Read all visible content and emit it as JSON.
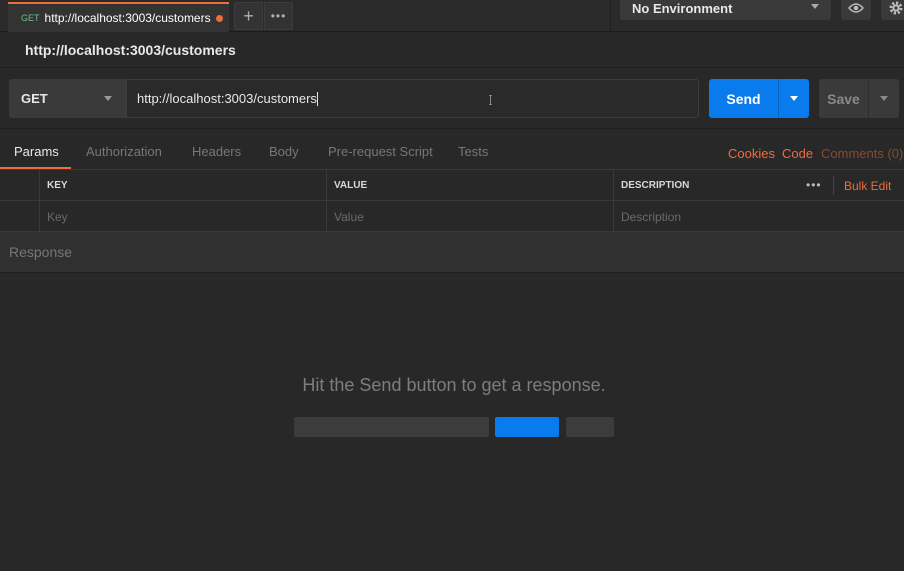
{
  "tab": {
    "method": "GET",
    "title": "http://localhost:3003/customers"
  },
  "environment": {
    "selected": "No Environment"
  },
  "request": {
    "name": "http://localhost:3003/customers",
    "method": "GET",
    "url": "http://localhost:3003/customers",
    "send_label": "Send",
    "save_label": "Save"
  },
  "request_tabs": [
    "Params",
    "Authorization",
    "Headers",
    "Body",
    "Pre-request Script",
    "Tests"
  ],
  "right_links": {
    "cookies": "Cookies",
    "code": "Code",
    "comments": "Comments (0)"
  },
  "params": {
    "headers": [
      "KEY",
      "VALUE",
      "DESCRIPTION"
    ],
    "placeholders": [
      "Key",
      "Value",
      "Description"
    ],
    "bulk_edit": "Bulk Edit",
    "more": "•••"
  },
  "response": {
    "title": "Response",
    "empty_message": "Hit the Send button to get a response."
  },
  "colors": {
    "accent": "#f26b3a",
    "primary": "#097bed",
    "method_get": "#64c28a"
  }
}
